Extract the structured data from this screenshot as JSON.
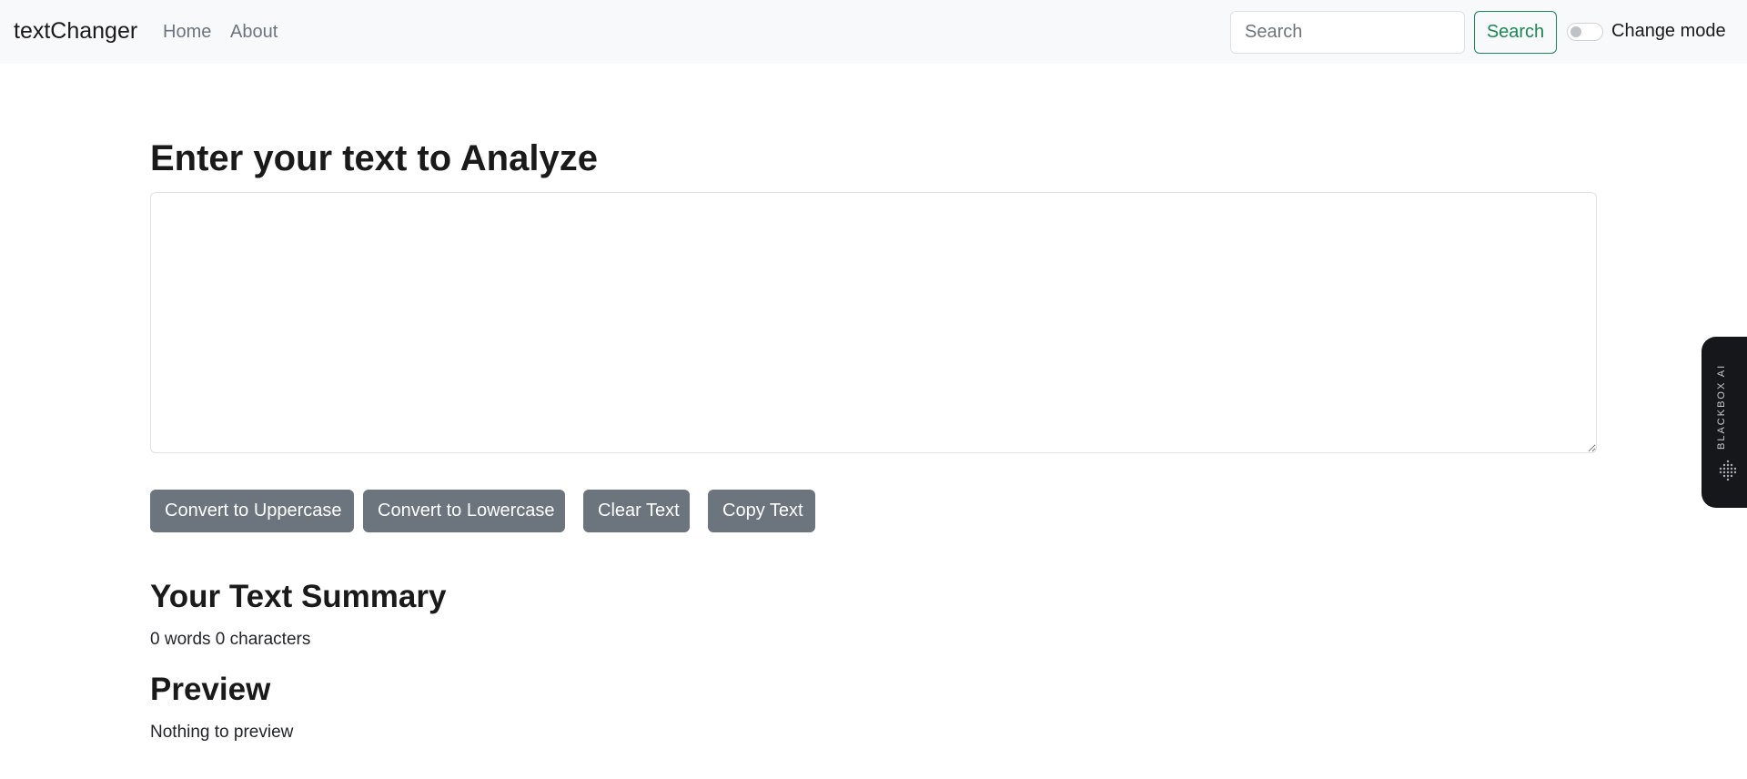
{
  "navbar": {
    "brand": "textChanger",
    "links": [
      {
        "label": "Home"
      },
      {
        "label": "About"
      }
    ],
    "search": {
      "placeholder": "Search",
      "value": "",
      "button_label": "Search"
    },
    "mode_toggle": {
      "label": "Change mode",
      "checked": false
    }
  },
  "main": {
    "heading": "Enter your text to Analyze",
    "textarea_value": "",
    "buttons": [
      {
        "label": "Convert to Uppercase"
      },
      {
        "label": "Convert to Lowercase"
      },
      {
        "label": "Clear Text"
      },
      {
        "label": "Copy Text"
      }
    ],
    "summary": {
      "heading": "Your Text Summary",
      "text": "0 words 0 characters"
    },
    "preview": {
      "heading": "Preview",
      "text": "Nothing to preview"
    }
  },
  "side_widget": {
    "label": "BLACKBOX AI",
    "icon": "dot-grid-icon"
  },
  "colors": {
    "navbar_bg": "#f8f9fa",
    "button_secondary": "#6c757d",
    "search_button": "#198754",
    "widget_bg": "#15171b"
  }
}
